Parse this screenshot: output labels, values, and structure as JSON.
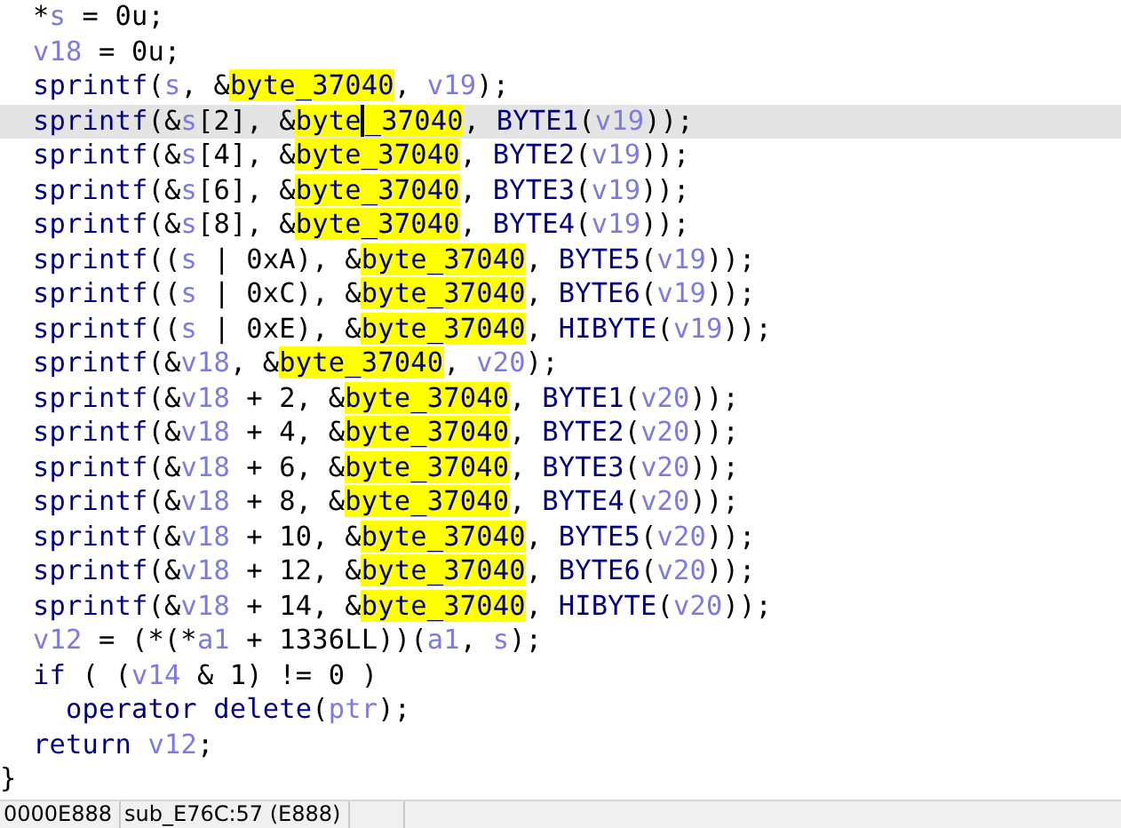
{
  "code_view": {
    "lines": [
      {
        "selected": false,
        "tokens": [
          {
            "kind": "punct",
            "text": "  *"
          },
          {
            "kind": "var",
            "text": "s"
          },
          {
            "kind": "punct",
            "text": " = 0u;"
          }
        ]
      },
      {
        "selected": false,
        "tokens": [
          {
            "kind": "var",
            "text": "  v18"
          },
          {
            "kind": "punct",
            "text": " = 0u;"
          }
        ]
      },
      {
        "selected": false,
        "tokens": [
          {
            "kind": "kw",
            "text": "  sprintf"
          },
          {
            "kind": "punct",
            "text": "("
          },
          {
            "kind": "var",
            "text": "s"
          },
          {
            "kind": "punct",
            "text": ", &"
          },
          {
            "kind": "hl",
            "text": "byte_37040"
          },
          {
            "kind": "punct",
            "text": ", "
          },
          {
            "kind": "var",
            "text": "v19"
          },
          {
            "kind": "punct",
            "text": ");"
          }
        ]
      },
      {
        "selected": true,
        "tokens": [
          {
            "kind": "kw",
            "text": "  sprintf"
          },
          {
            "kind": "punct",
            "text": "(&"
          },
          {
            "kind": "var",
            "text": "s"
          },
          {
            "kind": "punct",
            "text": "[2], &"
          },
          {
            "kind": "hl",
            "text": "byte"
          },
          {
            "kind": "hl",
            "text": "_37040",
            "caret": true
          },
          {
            "kind": "punct",
            "text": ", "
          },
          {
            "kind": "kw",
            "text": "BYTE1"
          },
          {
            "kind": "punct",
            "text": "("
          },
          {
            "kind": "var",
            "text": "v19"
          },
          {
            "kind": "punct",
            "text": "));"
          }
        ]
      },
      {
        "selected": false,
        "tokens": [
          {
            "kind": "kw",
            "text": "  sprintf"
          },
          {
            "kind": "punct",
            "text": "(&"
          },
          {
            "kind": "var",
            "text": "s"
          },
          {
            "kind": "punct",
            "text": "[4], &"
          },
          {
            "kind": "hl",
            "text": "byte_37040"
          },
          {
            "kind": "punct",
            "text": ", "
          },
          {
            "kind": "kw",
            "text": "BYTE2"
          },
          {
            "kind": "punct",
            "text": "("
          },
          {
            "kind": "var",
            "text": "v19"
          },
          {
            "kind": "punct",
            "text": "));"
          }
        ]
      },
      {
        "selected": false,
        "tokens": [
          {
            "kind": "kw",
            "text": "  sprintf"
          },
          {
            "kind": "punct",
            "text": "(&"
          },
          {
            "kind": "var",
            "text": "s"
          },
          {
            "kind": "punct",
            "text": "[6], &"
          },
          {
            "kind": "hl",
            "text": "byte_37040"
          },
          {
            "kind": "punct",
            "text": ", "
          },
          {
            "kind": "kw",
            "text": "BYTE3"
          },
          {
            "kind": "punct",
            "text": "("
          },
          {
            "kind": "var",
            "text": "v19"
          },
          {
            "kind": "punct",
            "text": "));"
          }
        ]
      },
      {
        "selected": false,
        "tokens": [
          {
            "kind": "kw",
            "text": "  sprintf"
          },
          {
            "kind": "punct",
            "text": "(&"
          },
          {
            "kind": "var",
            "text": "s"
          },
          {
            "kind": "punct",
            "text": "[8], &"
          },
          {
            "kind": "hl",
            "text": "byte_37040"
          },
          {
            "kind": "punct",
            "text": ", "
          },
          {
            "kind": "kw",
            "text": "BYTE4"
          },
          {
            "kind": "punct",
            "text": "("
          },
          {
            "kind": "var",
            "text": "v19"
          },
          {
            "kind": "punct",
            "text": "));"
          }
        ]
      },
      {
        "selected": false,
        "tokens": [
          {
            "kind": "kw",
            "text": "  sprintf"
          },
          {
            "kind": "punct",
            "text": "(("
          },
          {
            "kind": "var",
            "text": "s"
          },
          {
            "kind": "punct",
            "text": " | 0xA), &"
          },
          {
            "kind": "hl",
            "text": "byte_37040"
          },
          {
            "kind": "punct",
            "text": ", "
          },
          {
            "kind": "kw",
            "text": "BYTE5"
          },
          {
            "kind": "punct",
            "text": "("
          },
          {
            "kind": "var",
            "text": "v19"
          },
          {
            "kind": "punct",
            "text": "));"
          }
        ]
      },
      {
        "selected": false,
        "tokens": [
          {
            "kind": "kw",
            "text": "  sprintf"
          },
          {
            "kind": "punct",
            "text": "(("
          },
          {
            "kind": "var",
            "text": "s"
          },
          {
            "kind": "punct",
            "text": " | 0xC), &"
          },
          {
            "kind": "hl",
            "text": "byte_37040"
          },
          {
            "kind": "punct",
            "text": ", "
          },
          {
            "kind": "kw",
            "text": "BYTE6"
          },
          {
            "kind": "punct",
            "text": "("
          },
          {
            "kind": "var",
            "text": "v19"
          },
          {
            "kind": "punct",
            "text": "));"
          }
        ]
      },
      {
        "selected": false,
        "tokens": [
          {
            "kind": "kw",
            "text": "  sprintf"
          },
          {
            "kind": "punct",
            "text": "(("
          },
          {
            "kind": "var",
            "text": "s"
          },
          {
            "kind": "punct",
            "text": " | 0xE), &"
          },
          {
            "kind": "hl",
            "text": "byte_37040"
          },
          {
            "kind": "punct",
            "text": ", "
          },
          {
            "kind": "kw",
            "text": "HIBYTE"
          },
          {
            "kind": "punct",
            "text": "("
          },
          {
            "kind": "var",
            "text": "v19"
          },
          {
            "kind": "punct",
            "text": "));"
          }
        ]
      },
      {
        "selected": false,
        "tokens": [
          {
            "kind": "kw",
            "text": "  sprintf"
          },
          {
            "kind": "punct",
            "text": "(&"
          },
          {
            "kind": "var",
            "text": "v18"
          },
          {
            "kind": "punct",
            "text": ", &"
          },
          {
            "kind": "hl",
            "text": "byte_37040"
          },
          {
            "kind": "punct",
            "text": ", "
          },
          {
            "kind": "var",
            "text": "v20"
          },
          {
            "kind": "punct",
            "text": ");"
          }
        ]
      },
      {
        "selected": false,
        "tokens": [
          {
            "kind": "kw",
            "text": "  sprintf"
          },
          {
            "kind": "punct",
            "text": "(&"
          },
          {
            "kind": "var",
            "text": "v18"
          },
          {
            "kind": "punct",
            "text": " + 2, &"
          },
          {
            "kind": "hl",
            "text": "byte_37040"
          },
          {
            "kind": "punct",
            "text": ", "
          },
          {
            "kind": "kw",
            "text": "BYTE1"
          },
          {
            "kind": "punct",
            "text": "("
          },
          {
            "kind": "var",
            "text": "v20"
          },
          {
            "kind": "punct",
            "text": "));"
          }
        ]
      },
      {
        "selected": false,
        "tokens": [
          {
            "kind": "kw",
            "text": "  sprintf"
          },
          {
            "kind": "punct",
            "text": "(&"
          },
          {
            "kind": "var",
            "text": "v18"
          },
          {
            "kind": "punct",
            "text": " + 4, &"
          },
          {
            "kind": "hl",
            "text": "byte_37040"
          },
          {
            "kind": "punct",
            "text": ", "
          },
          {
            "kind": "kw",
            "text": "BYTE2"
          },
          {
            "kind": "punct",
            "text": "("
          },
          {
            "kind": "var",
            "text": "v20"
          },
          {
            "kind": "punct",
            "text": "));"
          }
        ]
      },
      {
        "selected": false,
        "tokens": [
          {
            "kind": "kw",
            "text": "  sprintf"
          },
          {
            "kind": "punct",
            "text": "(&"
          },
          {
            "kind": "var",
            "text": "v18"
          },
          {
            "kind": "punct",
            "text": " + 6, &"
          },
          {
            "kind": "hl",
            "text": "byte_37040"
          },
          {
            "kind": "punct",
            "text": ", "
          },
          {
            "kind": "kw",
            "text": "BYTE3"
          },
          {
            "kind": "punct",
            "text": "("
          },
          {
            "kind": "var",
            "text": "v20"
          },
          {
            "kind": "punct",
            "text": "));"
          }
        ]
      },
      {
        "selected": false,
        "tokens": [
          {
            "kind": "kw",
            "text": "  sprintf"
          },
          {
            "kind": "punct",
            "text": "(&"
          },
          {
            "kind": "var",
            "text": "v18"
          },
          {
            "kind": "punct",
            "text": " + 8, &"
          },
          {
            "kind": "hl",
            "text": "byte_37040"
          },
          {
            "kind": "punct",
            "text": ", "
          },
          {
            "kind": "kw",
            "text": "BYTE4"
          },
          {
            "kind": "punct",
            "text": "("
          },
          {
            "kind": "var",
            "text": "v20"
          },
          {
            "kind": "punct",
            "text": "));"
          }
        ]
      },
      {
        "selected": false,
        "tokens": [
          {
            "kind": "kw",
            "text": "  sprintf"
          },
          {
            "kind": "punct",
            "text": "(&"
          },
          {
            "kind": "var",
            "text": "v18"
          },
          {
            "kind": "punct",
            "text": " + 10, &"
          },
          {
            "kind": "hl",
            "text": "byte_37040"
          },
          {
            "kind": "punct",
            "text": ", "
          },
          {
            "kind": "kw",
            "text": "BYTE5"
          },
          {
            "kind": "punct",
            "text": "("
          },
          {
            "kind": "var",
            "text": "v20"
          },
          {
            "kind": "punct",
            "text": "));"
          }
        ]
      },
      {
        "selected": false,
        "tokens": [
          {
            "kind": "kw",
            "text": "  sprintf"
          },
          {
            "kind": "punct",
            "text": "(&"
          },
          {
            "kind": "var",
            "text": "v18"
          },
          {
            "kind": "punct",
            "text": " + 12, &"
          },
          {
            "kind": "hl",
            "text": "byte_37040"
          },
          {
            "kind": "punct",
            "text": ", "
          },
          {
            "kind": "kw",
            "text": "BYTE6"
          },
          {
            "kind": "punct",
            "text": "("
          },
          {
            "kind": "var",
            "text": "v20"
          },
          {
            "kind": "punct",
            "text": "));"
          }
        ]
      },
      {
        "selected": false,
        "tokens": [
          {
            "kind": "kw",
            "text": "  sprintf"
          },
          {
            "kind": "punct",
            "text": "(&"
          },
          {
            "kind": "var",
            "text": "v18"
          },
          {
            "kind": "punct",
            "text": " + 14, &"
          },
          {
            "kind": "hl",
            "text": "byte_37040"
          },
          {
            "kind": "punct",
            "text": ", "
          },
          {
            "kind": "kw",
            "text": "HIBYTE"
          },
          {
            "kind": "punct",
            "text": "("
          },
          {
            "kind": "var",
            "text": "v20"
          },
          {
            "kind": "punct",
            "text": "));"
          }
        ]
      },
      {
        "selected": false,
        "tokens": [
          {
            "kind": "var",
            "text": "  v12"
          },
          {
            "kind": "punct",
            "text": " = (*(*"
          },
          {
            "kind": "var",
            "text": "a1"
          },
          {
            "kind": "punct",
            "text": " + 1336LL))("
          },
          {
            "kind": "var",
            "text": "a1"
          },
          {
            "kind": "punct",
            "text": ", "
          },
          {
            "kind": "var",
            "text": "s"
          },
          {
            "kind": "punct",
            "text": ");"
          }
        ]
      },
      {
        "selected": false,
        "tokens": [
          {
            "kind": "kw",
            "text": "  if"
          },
          {
            "kind": "punct",
            "text": " ( ("
          },
          {
            "kind": "var",
            "text": "v14"
          },
          {
            "kind": "punct",
            "text": " & 1) != 0 )"
          }
        ]
      },
      {
        "selected": false,
        "tokens": [
          {
            "kind": "kw",
            "text": "    operator delete"
          },
          {
            "kind": "punct",
            "text": "("
          },
          {
            "kind": "var",
            "text": "ptr"
          },
          {
            "kind": "punct",
            "text": ");"
          }
        ]
      },
      {
        "selected": false,
        "tokens": [
          {
            "kind": "kw",
            "text": "  return "
          },
          {
            "kind": "var",
            "text": "v12"
          },
          {
            "kind": "punct",
            "text": ";"
          }
        ]
      },
      {
        "selected": false,
        "tokens": [
          {
            "kind": "punct",
            "text": "}"
          }
        ]
      }
    ]
  },
  "status_bar": {
    "items": [
      "0000E888",
      "sub_E76C:57 (E888)"
    ]
  }
}
